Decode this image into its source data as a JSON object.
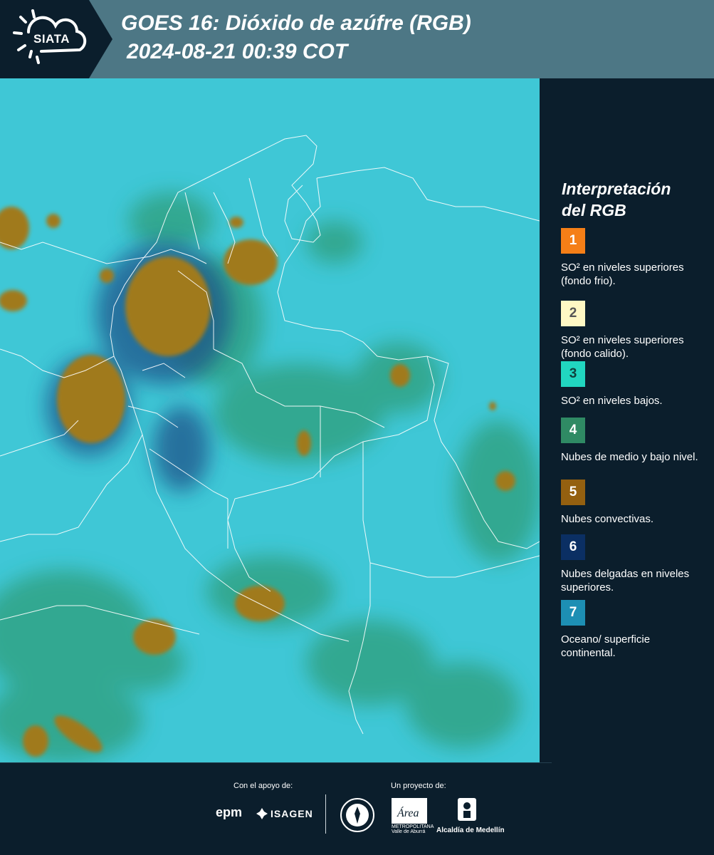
{
  "header": {
    "logo_text": "SIATA",
    "title": "GOES 16: Dióxido de azúfre (RGB)",
    "subtitle": "2024-08-21 00:39 COT"
  },
  "legend": {
    "title_line1": "Interpretación",
    "title_line2": "del RGB",
    "items": [
      {
        "number": "1",
        "label": "SO² en niveles superiores (fondo frio).",
        "color": "#f57f17",
        "text_color": "#ffffff"
      },
      {
        "number": "2",
        "label": "SO² en niveles superiores (fondo calido).",
        "color": "#fff8c4",
        "text_color": "#555555"
      },
      {
        "number": "3",
        "label": "SO² en niveles bajos.",
        "color": "#21d6c0",
        "text_color": "#10403c"
      },
      {
        "number": "4",
        "label": "Nubes de medio y bajo nivel.",
        "color": "#2f8a64",
        "text_color": "#ffffff"
      },
      {
        "number": "5",
        "label": "Nubes convectivas.",
        "color": "#946010",
        "text_color": "#ffffff"
      },
      {
        "number": "6",
        "label": "Nubes delgadas en niveles superiores.",
        "color": "#0b2f63",
        "text_color": "#ffffff"
      },
      {
        "number": "7",
        "label": "Oceano/ superficie continental.",
        "color": "#1d8fb4",
        "text_color": "#ffffff"
      }
    ]
  },
  "footer": {
    "support_label": "Con el apoyo de:",
    "project_label": "Un proyecto de:",
    "epm": "epm",
    "isagen": "ISAGEN",
    "area_text": "METROPOLITANA Valle de Aburrá",
    "area_script": "Área",
    "alcaldia": "Alcaldía de Medellín"
  },
  "colors": {
    "header_bg": "#4d7785",
    "dark_bg": "#0b1e2c",
    "map_ocean": "#3fc7d6",
    "map_green": "#2f9e7a",
    "map_convective": "#a07a1e",
    "border_white": "#ffffff"
  }
}
